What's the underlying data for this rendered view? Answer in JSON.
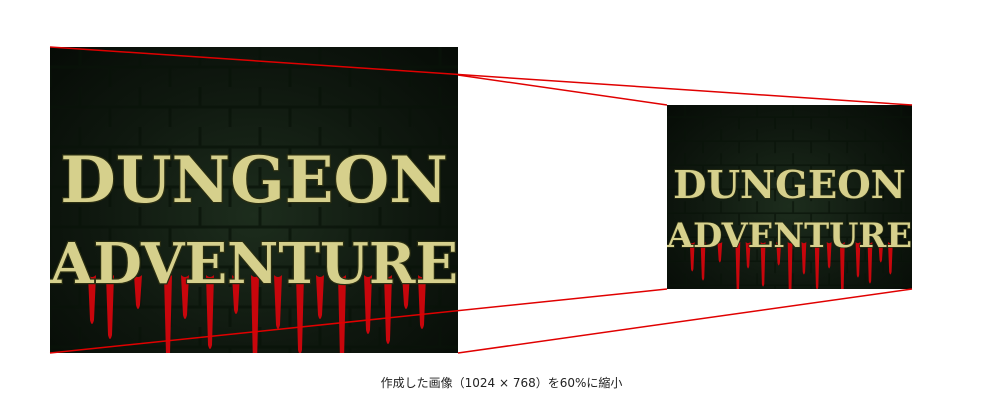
{
  "title_art": {
    "line1": "DUNGEON",
    "line2": "ADVENTURE",
    "text_color": "#d6d08c",
    "outline_color": "#2a2e12",
    "blood_color": "#c8060c",
    "wall_color": "#142214"
  },
  "connector_color": "#e00000",
  "caption": "作成した画像（1024 × 768）を60%に縮小"
}
